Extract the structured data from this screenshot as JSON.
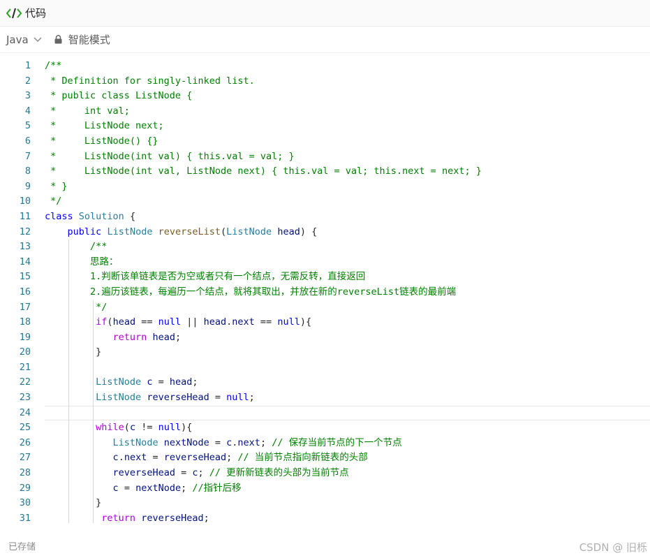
{
  "window": {
    "title": "代码"
  },
  "toolbar": {
    "language": "Java",
    "mode_label": "智能模式"
  },
  "colors": {
    "keyword": "#0000ff",
    "control": "#af00db",
    "type": "#267f99",
    "comment": "#008000",
    "line_number": "#237893",
    "icon_green": "#2ea121"
  },
  "editor": {
    "current_line": 24,
    "lines": [
      {
        "n": "1",
        "t": "/**",
        "cls": "c"
      },
      {
        "n": "2",
        "t": " * Definition for singly-linked list.",
        "cls": "c"
      },
      {
        "n": "3",
        "t": " * public class ListNode {",
        "cls": "c"
      },
      {
        "n": "4",
        "t": " *     int val;",
        "cls": "c"
      },
      {
        "n": "5",
        "t": " *     ListNode next;",
        "cls": "c"
      },
      {
        "n": "6",
        "t": " *     ListNode() {}",
        "cls": "c"
      },
      {
        "n": "7",
        "t": " *     ListNode(int val) { this.val = val; }",
        "cls": "c"
      },
      {
        "n": "8",
        "t": " *     ListNode(int val, ListNode next) { this.val = val; this.next = next; }",
        "cls": "c"
      },
      {
        "n": "9",
        "t": " * }",
        "cls": "c"
      },
      {
        "n": "10",
        "t": " */",
        "cls": "c"
      },
      {
        "n": "11",
        "html": "<span class='k'>class</span> <span class='t'>Solution</span> {"
      },
      {
        "n": "12",
        "html": "    <span class='k'>public</span> <span class='t'>ListNode</span> <span class='f'>reverseList</span>(<span class='t'>ListNode</span> <span class='n'>head</span>) {"
      },
      {
        "n": "13",
        "t": "        /**",
        "cls": "c"
      },
      {
        "n": "14",
        "t": "        思路：",
        "cls": "c"
      },
      {
        "n": "15",
        "t": "        1.判断该单链表是否为空或者只有一个结点，无需反转，直接返回",
        "cls": "c"
      },
      {
        "n": "16",
        "t": "        2.遍历该链表，每遍历一个结点，就将其取出，并放在新的reverseList链表的最前端",
        "cls": "c"
      },
      {
        "n": "17",
        "t": "         */",
        "cls": "c"
      },
      {
        "n": "18",
        "html": "         <span class='kw'>if</span>(<span class='n'>head</span> == <span class='k'>null</span> || <span class='n'>head</span>.<span class='n'>next</span> == <span class='k'>null</span>){"
      },
      {
        "n": "19",
        "html": "            <span class='kw'>return</span> <span class='n'>head</span>;"
      },
      {
        "n": "20",
        "html": "         }"
      },
      {
        "n": "21",
        "html": ""
      },
      {
        "n": "22",
        "html": "         <span class='t'>ListNode</span> <span class='n'>c</span> = <span class='n'>head</span>;"
      },
      {
        "n": "23",
        "html": "         <span class='t'>ListNode</span> <span class='n'>reverseHead</span> = <span class='k'>null</span>;"
      },
      {
        "n": "24",
        "html": ""
      },
      {
        "n": "25",
        "html": "         <span class='kw'>while</span>(<span class='n'>c</span> != <span class='k'>null</span>){"
      },
      {
        "n": "26",
        "html": "            <span class='t'>ListNode</span> <span class='n'>nextNode</span> = <span class='n'>c</span>.<span class='n'>next</span>; <span class='c'>// 保存当前节点的下一个节点</span>"
      },
      {
        "n": "27",
        "html": "            <span class='n'>c</span>.<span class='n'>next</span> = <span class='n'>reverseHead</span>; <span class='c'>// 当前节点指向新链表的头部</span>"
      },
      {
        "n": "28",
        "html": "            <span class='n'>reverseHead</span> = <span class='n'>c</span>; <span class='c'>// 更新新链表的头部为当前节点</span>"
      },
      {
        "n": "29",
        "html": "            <span class='n'>c</span> = <span class='n'>nextNode</span>; <span class='c'>//指针后移</span>"
      },
      {
        "n": "30",
        "html": "         }"
      },
      {
        "n": "31",
        "html": "          <span class='kw'>return</span> <span class='n'>reverseHead</span>;"
      }
    ]
  },
  "footer": {
    "status": "已存储",
    "watermark": "CSDN @ 旧栎"
  }
}
